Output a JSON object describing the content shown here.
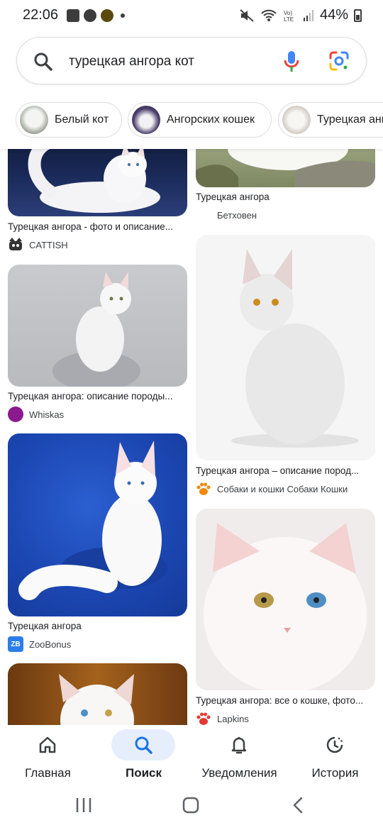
{
  "status": {
    "time": "22:06",
    "battery": "44%"
  },
  "search": {
    "query": "турецкая ангора кот"
  },
  "chips": [
    {
      "label": "Белый кот"
    },
    {
      "label": "Ангорских кошек"
    },
    {
      "label": "Турецкая ангора"
    }
  ],
  "results": {
    "left": [
      {
        "title": "Турецкая ангора - фото и описание...",
        "source": "CATTISH"
      },
      {
        "title": "Турецкая ангора: описание породы...",
        "source": "Whiskas"
      },
      {
        "title": "Турецкая ангора",
        "source": "ZooBonus",
        "favicon_text": "ZB"
      }
    ],
    "right": [
      {
        "title": "Турецкая ангора",
        "source": "Бетховен"
      },
      {
        "title": "Турецкая ангора – описание пород...",
        "source": "Собаки и кошки Собаки Кошки"
      },
      {
        "title": "Турецкая ангора: все о кошке, фото...",
        "source": "Lapkins"
      }
    ]
  },
  "nav": [
    {
      "label": "Главная",
      "icon": "home-icon"
    },
    {
      "label": "Поиск",
      "icon": "search-icon",
      "active": true
    },
    {
      "label": "Уведомления",
      "icon": "bell-icon"
    },
    {
      "label": "История",
      "icon": "history-icon"
    }
  ],
  "colors": {
    "accent": "#1a73e8",
    "active_pill": "#e6eefc"
  }
}
